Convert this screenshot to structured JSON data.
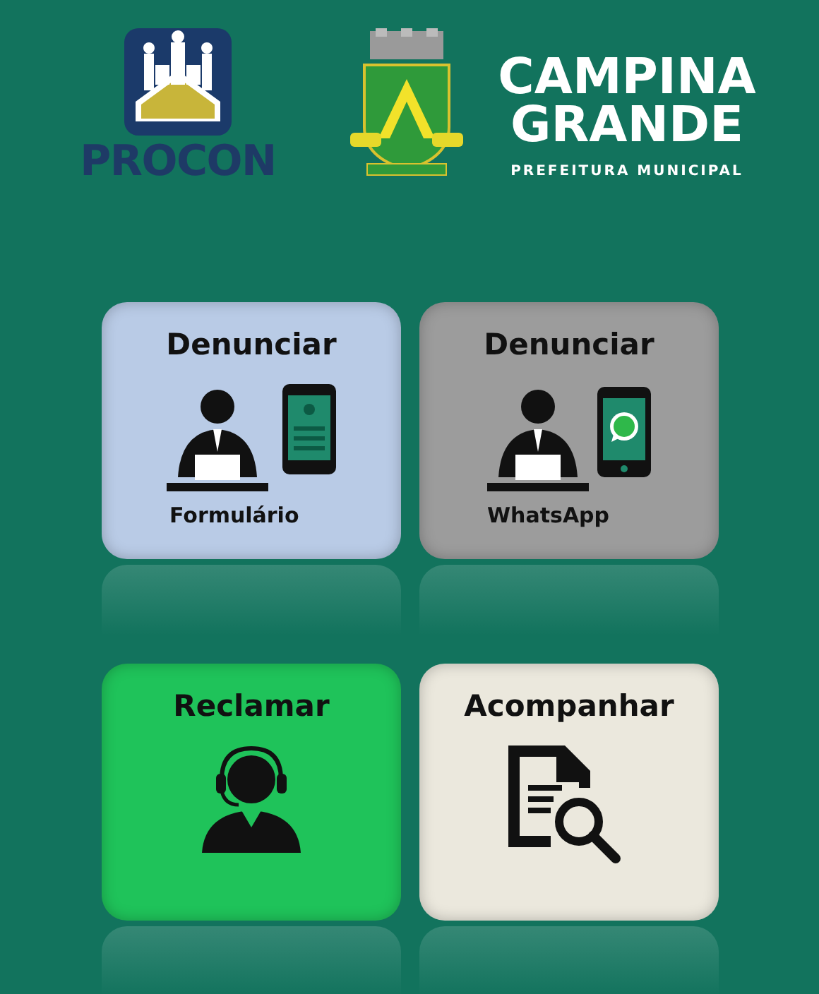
{
  "header": {
    "procon_logo": {
      "text": "PROCON"
    },
    "city_logo": {
      "name_line_1": "CAMPINA",
      "name_line_2": "GRANDE",
      "subtitle": "PREFEITURA MUNICIPAL"
    }
  },
  "tiles": [
    {
      "title": "Denunciar",
      "caption": "Formulário",
      "kind": "form",
      "color": "#b9cbe6"
    },
    {
      "title": "Denunciar",
      "caption": "WhatsApp",
      "kind": "whatsapp",
      "color": "#9c9c9c"
    },
    {
      "title": "Reclamar",
      "kind": "headset",
      "color": "#1fc35a"
    },
    {
      "title": "Acompanhar",
      "kind": "search",
      "color": "#ebe8dd"
    }
  ]
}
